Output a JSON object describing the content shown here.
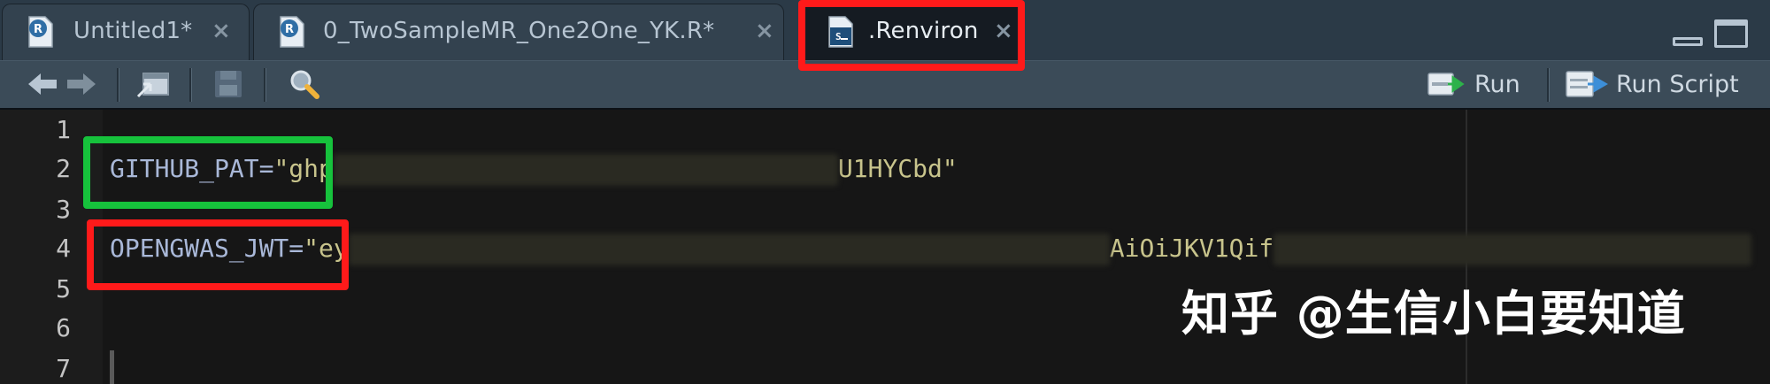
{
  "tabs": [
    {
      "label": "Untitled1*",
      "icon": "r-file-icon",
      "active": false
    },
    {
      "label": "0_TwoSampleMR_One2One_YK.R*",
      "icon": "r-file-icon",
      "active": false
    },
    {
      "label": ".Renviron",
      "icon": "shell-file-icon",
      "active": true
    }
  ],
  "tab_close_glyph": "×",
  "toolbar": {
    "back_icon": "arrow-left-icon",
    "forward_icon": "arrow-right-icon",
    "show_in_window_icon": "popout-icon",
    "save_icon": "floppy-disk-icon",
    "find_icon": "magnifier-icon",
    "run_label": "Run",
    "run_script_label": "Run Script"
  },
  "editor": {
    "line_numbers": [
      "1",
      "2",
      "3",
      "4",
      "5",
      "6",
      "7"
    ],
    "lines": {
      "line2": {
        "var": "GITHUB_PAT=",
        "open_quote": "\"",
        "str_start": "ghp",
        "str_end": "U1HYCbd\""
      },
      "line4": {
        "var": "OPENGWAS_JWT=",
        "open_quote": "\"",
        "str_start": "ey",
        "str_mid": "AiOiJKV1Qi",
        "str_end": "f"
      }
    }
  },
  "annotations": {
    "tab_highlight_color": "#ff1a1a",
    "github_highlight_color": "#16c23c",
    "opengwas_highlight_color": "#ff1a1a"
  },
  "watermark": "知乎 @生信小白要知道"
}
